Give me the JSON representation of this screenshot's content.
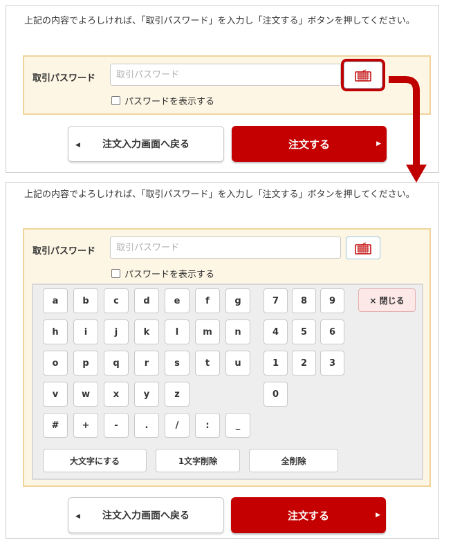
{
  "instruction": "上記の内容でよろしければ、「取引パスワード」を入力し「注文する」ボタンを押してください。",
  "password": {
    "label": "取引パスワード",
    "placeholder": "取引パスワード",
    "show_label": "パスワードを表示する"
  },
  "buttons": {
    "back": "注文入力画面へ戻る",
    "order": "注文する"
  },
  "keypad": {
    "letter_rows": [
      [
        "a",
        "b",
        "c",
        "d",
        "e",
        "f",
        "g"
      ],
      [
        "h",
        "i",
        "j",
        "k",
        "l",
        "m",
        "n"
      ],
      [
        "o",
        "p",
        "q",
        "r",
        "s",
        "t",
        "u"
      ],
      [
        "v",
        "w",
        "x",
        "y",
        "z"
      ],
      [
        "#",
        "+",
        "-",
        ".",
        "/",
        ":",
        "_"
      ]
    ],
    "number_rows": [
      [
        "7",
        "8",
        "9"
      ],
      [
        "4",
        "5",
        "6"
      ],
      [
        "1",
        "2",
        "3"
      ],
      [
        "0"
      ]
    ],
    "close": "× 閉じる",
    "uppercase": "大文字にする",
    "delete_one": "1文字削除",
    "delete_all": "全削除"
  },
  "colors": {
    "accent_red": "#c50000",
    "highlight_red": "#c00000",
    "panel_bg": "#fdf6e4",
    "panel_border": "#f0d49a"
  },
  "icons": {
    "keyboard": "keyboard-icon",
    "back": "triangle-left-icon",
    "order": "triangle-right-icon",
    "annotation": "arrow-down-icon"
  }
}
